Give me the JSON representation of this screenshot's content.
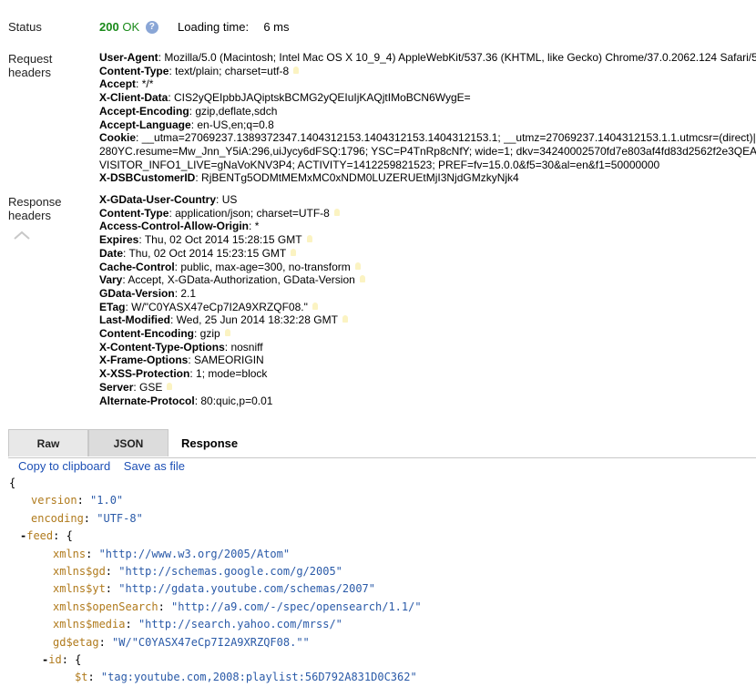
{
  "status": {
    "label": "Status",
    "code": "200",
    "text": "OK",
    "loading_label": "Loading time:",
    "loading_value": "6 ms"
  },
  "request": {
    "label_line1": "Request",
    "label_line2": "headers",
    "lines": [
      {
        "key": "User-Agent",
        "value": "Mozilla/5.0 (Macintosh; Intel Mac OS X 10_9_4) AppleWebKit/537.36 (KHTML, like Gecko) Chrome/37.0.2062.124 Safari/5",
        "bulb": false
      },
      {
        "key": "Content-Type",
        "value": "text/plain; charset=utf-8",
        "bulb": true
      },
      {
        "key": "Accept",
        "value": "*/*",
        "bulb": false
      },
      {
        "key": "X-Client-Data",
        "value": "CIS2yQEIpbbJAQiptskBCMG2yQEIuIjKAQjtIMoBCN6WygE=",
        "bulb": false
      },
      {
        "key": "Accept-Encoding",
        "value": "gzip,deflate,sdch",
        "bulb": false
      },
      {
        "key": "Accept-Language",
        "value": "en-US,en;q=0.8",
        "bulb": false
      },
      {
        "key": "Cookie",
        "value": "__utma=27069237.1389372347.1404312153.1404312153.1404312153.1; __utmz=27069237.1404312153.1.1.utmcsr=(direct)|",
        "bulb": false
      },
      {
        "key": "",
        "value": "280YC.resume=Mw_Jnn_Y5iA:296,uiJycy6dFSQ:1796; YSC=P4TnRp8cNfY; wide=1; dkv=34240002570fd7e803af4fd83d2562f2e3QEA",
        "bulb": false
      },
      {
        "key": "",
        "value": "VISITOR_INFO1_LIVE=gNaVoKNV3P4; ACTIVITY=1412259821523; PREF=fv=15.0.0&f5=30&al=en&f1=50000000",
        "bulb": false
      },
      {
        "key": "X-DSBCustomerID",
        "value": "RjBENTg5ODMtMEMxMC0xNDM0LUZERUEtMjI3NjdGMzkyNjk4",
        "bulb": false
      }
    ]
  },
  "response": {
    "label_line1": "Response",
    "label_line2": "headers",
    "lines": [
      {
        "key": "X-GData-User-Country",
        "value": "US",
        "bulb": false
      },
      {
        "key": "Content-Type",
        "value": "application/json; charset=UTF-8",
        "bulb": true
      },
      {
        "key": "Access-Control-Allow-Origin",
        "value": "*",
        "bulb": false
      },
      {
        "key": "Expires",
        "value": "Thu, 02 Oct 2014 15:28:15 GMT",
        "bulb": true
      },
      {
        "key": "Date",
        "value": "Thu, 02 Oct 2014 15:23:15 GMT",
        "bulb": true
      },
      {
        "key": "Cache-Control",
        "value": "public, max-age=300, no-transform",
        "bulb": true
      },
      {
        "key": "Vary",
        "value": "Accept, X-GData-Authorization, GData-Version",
        "bulb": true
      },
      {
        "key": "GData-Version",
        "value": "2.1",
        "bulb": false
      },
      {
        "key": "ETag",
        "value": "W/\"C0YASX47eCp7I2A9XRZQF08.\"",
        "bulb": true
      },
      {
        "key": "Last-Modified",
        "value": "Wed, 25 Jun 2014 18:32:28 GMT",
        "bulb": true
      },
      {
        "key": "Content-Encoding",
        "value": "gzip",
        "bulb": true
      },
      {
        "key": "X-Content-Type-Options",
        "value": "nosniff",
        "bulb": false
      },
      {
        "key": "X-Frame-Options",
        "value": "SAMEORIGIN",
        "bulb": false
      },
      {
        "key": "X-XSS-Protection",
        "value": "1; mode=block",
        "bulb": false
      },
      {
        "key": "Server",
        "value": "GSE",
        "bulb": true
      },
      {
        "key": "Alternate-Protocol",
        "value": "80:quic,p=0.01",
        "bulb": false
      }
    ]
  },
  "tabs": {
    "raw": "Raw",
    "json": "JSON",
    "title": "Response"
  },
  "links": {
    "copy": "Copy to clipboard",
    "save": "Save as file"
  },
  "json_view": [
    {
      "indent": 0,
      "toggle": "",
      "key": "",
      "value": "",
      "brace": "{"
    },
    {
      "indent": 2,
      "toggle": "",
      "key": "version",
      "value": "\"1.0\"",
      "brace": ""
    },
    {
      "indent": 2,
      "toggle": "",
      "key": "encoding",
      "value": "\"UTF-8\"",
      "brace": ""
    },
    {
      "indent": 1,
      "toggle": "-",
      "key": "feed",
      "value": "",
      "brace": "{"
    },
    {
      "indent": 4,
      "toggle": "",
      "key": "xmlns",
      "value": "\"http://www.w3.org/2005/Atom\"",
      "brace": ""
    },
    {
      "indent": 4,
      "toggle": "",
      "key": "xmlns$gd",
      "value": "\"http://schemas.google.com/g/2005\"",
      "brace": ""
    },
    {
      "indent": 4,
      "toggle": "",
      "key": "xmlns$yt",
      "value": "\"http://gdata.youtube.com/schemas/2007\"",
      "brace": ""
    },
    {
      "indent": 4,
      "toggle": "",
      "key": "xmlns$openSearch",
      "value": "\"http://a9.com/-/spec/opensearch/1.1/\"",
      "brace": ""
    },
    {
      "indent": 4,
      "toggle": "",
      "key": "xmlns$media",
      "value": "\"http://search.yahoo.com/mrss/\"",
      "brace": ""
    },
    {
      "indent": 4,
      "toggle": "",
      "key": "gd$etag",
      "value": "\"W/\"C0YASX47eCp7I2A9XRZQF08.\"\"",
      "brace": ""
    },
    {
      "indent": 3,
      "toggle": "-",
      "key": "id",
      "value": "",
      "brace": "{"
    },
    {
      "indent": 6,
      "toggle": "",
      "key": "$t",
      "value": "\"tag:youtube.com,2008:playlist:56D792A831D0C362\"",
      "brace": ""
    }
  ]
}
